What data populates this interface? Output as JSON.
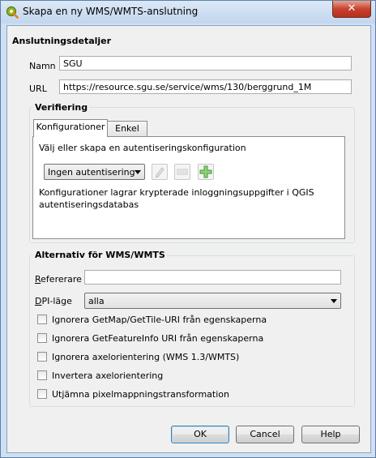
{
  "window": {
    "title": "Skapa en ny WMS/WMTS-anslutning",
    "close_glyph": "✕"
  },
  "connection": {
    "group_title": "Anslutningsdetaljer",
    "name_label": "Namn",
    "name_value": "SGU",
    "url_label": "URL",
    "url_value": "https://resource.sgu.se/service/wms/130/berggrund_1M"
  },
  "auth": {
    "group_title": "Verifiering",
    "tabs": [
      {
        "label": "Konfigurationer",
        "active": true
      },
      {
        "label": "Enkel",
        "active": false
      }
    ],
    "prompt": "Välj eller skapa en autentiseringskonfiguration",
    "config_selected": "Ingen autentisering",
    "info_line1": "Konfigurationer lagrar krypterade inloggningsuppgifter i QGIS",
    "info_line2": "autentiseringsdatabas"
  },
  "options": {
    "group_title": "Alternativ för WMS/WMTS",
    "referer_label_u": "R",
    "referer_label_rest": "efererare",
    "referer_value": "",
    "dpi_label_u": "D",
    "dpi_label_rest": "PI-läge",
    "dpi_selected": "alla",
    "checkboxes": [
      {
        "label": "Ignorera GetMap/GetTile-URI från egenskaperna",
        "checked": false
      },
      {
        "label": "Ignorera GetFeatureInfo URI från egenskaperna",
        "checked": false
      },
      {
        "label": "Ignorera axelorientering (WMS 1.3/WMTS)",
        "checked": false
      },
      {
        "label": "Invertera axelorientering",
        "checked": false
      },
      {
        "label": "Utjämna pixelmappningstransformation",
        "checked": false
      }
    ]
  },
  "buttons": {
    "ok": "OK",
    "cancel": "Cancel",
    "help": "Help"
  },
  "icons": {
    "app": "qgis-icon",
    "edit": "pencil-icon",
    "remove": "remove-icon",
    "add": "add-icon"
  },
  "colors": {
    "accent": "#3c7fb1",
    "add_green": "#3f9c35"
  }
}
